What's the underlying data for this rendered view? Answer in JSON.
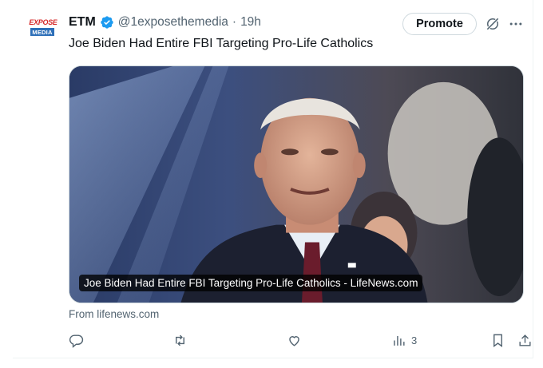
{
  "account": {
    "name": "ETM",
    "handle": "@1exposethemedia",
    "separator": "·",
    "time": "19h",
    "avatar_line1": "EXPOSE",
    "avatar_line2": "MEDIA"
  },
  "header": {
    "promote_label": "Promote"
  },
  "tweet": {
    "text": "Joe Biden Had Entire FBI Targeting Pro-Life Catholics"
  },
  "card": {
    "caption": "Joe Biden Had Entire FBI Targeting Pro-Life Catholics - LifeNews.com",
    "source": "From lifenews.com"
  },
  "actions": {
    "views_count": "3"
  },
  "colors": {
    "text_primary": "#0f1419",
    "text_secondary": "#536471",
    "verified": "#1d9bf0",
    "border": "#cfd9de"
  },
  "icons": [
    "verified-badge-icon",
    "grok-icon",
    "more-icon",
    "reply-icon",
    "retweet-icon",
    "like-icon",
    "views-icon",
    "bookmark-icon",
    "share-icon"
  ]
}
